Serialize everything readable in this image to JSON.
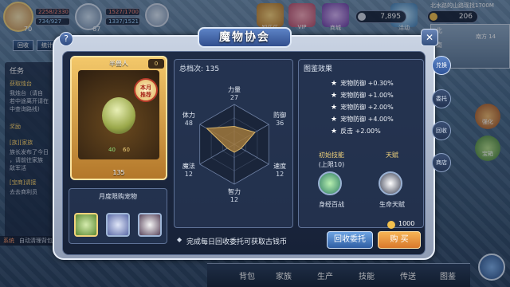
{
  "hud": {
    "left_hp": "2258/2330",
    "left_mp": "734/927",
    "mid_hp": "1527/1700",
    "mid_mp": "1337/1521",
    "level": "70",
    "pet_level": "67",
    "btn_return": "回收",
    "btn_stats": "统计",
    "task_tab": "任务",
    "task_title": "获取烛台",
    "task_lines": [
      "我烛台（请自",
      "若中途离开请在",
      "中查询路线)"
    ],
    "quest_title": "奖励",
    "family_title": "[族][家族",
    "family_lines": [
      "族长发布了今日",
      "，请前往家族",
      "敌军活"
    ],
    "bottom_title": "[宝商]请接",
    "bottom_line": "去去商利员",
    "chat_channel": "系统",
    "chat_text": "自动清理背包",
    "money": "7,895",
    "gold": "206",
    "location": "北水路的山路现找1700M ",
    "map_labels": [
      "北",
      "南",
      "西",
      "东"
    ],
    "map_tag": "南方 14",
    "top_icons": [
      "知乐乐",
      "VIP",
      "商城",
      "活动"
    ],
    "right_icons": [
      "强化",
      "宝箱"
    ],
    "bottom_nav": [
      "背包",
      "家族",
      "生产",
      "技能",
      "传送",
      "图鉴"
    ]
  },
  "dialog": {
    "title": "魔物协会",
    "help": "?",
    "close": "✕",
    "card": {
      "name": "半兽人",
      "badge_count": "0",
      "stamp": [
        "本月",
        "推荐"
      ],
      "stat_a": "40",
      "stat_b": "60",
      "power": "135"
    },
    "monthly_title": "月度限购宠物",
    "total_label": "总档次: 135",
    "radar": {
      "labels": [
        "力量",
        "防御",
        "速度",
        "智力",
        "魔法",
        "体力"
      ],
      "values": [
        27,
        36,
        12,
        12,
        12,
        48
      ]
    },
    "effects_title": "图鉴效果",
    "effects": [
      "宠物防御 +0.30%",
      "宠物防御 +1.00%",
      "宠物防御 +2.00%",
      "宠物防御 +4.00%",
      "反击 +2.00%"
    ],
    "skill_title": "初始技能",
    "skill_sub": "(上限10)",
    "skill_name": "身经百战",
    "talent_title": "天赋",
    "talent_name": "生命天赋",
    "notice": "完成每日回收委托可获取古钱币",
    "price": "1000",
    "btn_recycle": "回收委托",
    "btn_buy": "购 买",
    "side_tabs": [
      "兑换",
      "委托",
      "回收",
      "商店"
    ]
  }
}
